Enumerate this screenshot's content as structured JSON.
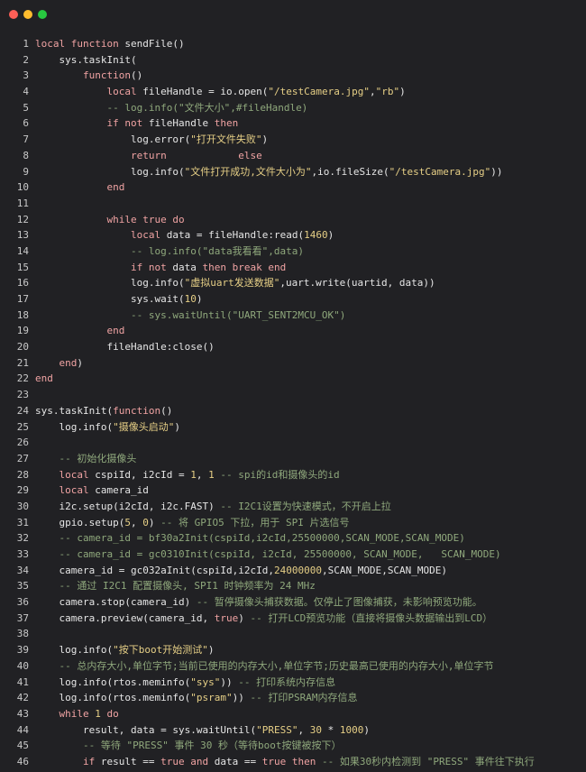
{
  "window": {
    "buttons": [
      "close",
      "minimize",
      "maximize"
    ],
    "colors": {
      "close": "#ff5f57",
      "minimize": "#febc2e",
      "maximize": "#28c840"
    }
  },
  "code_lines": [
    {
      "n": "1",
      "text": "local function sendFile()"
    },
    {
      "n": "2",
      "text": "    sys.taskInit("
    },
    {
      "n": "3",
      "text": "        function()"
    },
    {
      "n": "4",
      "text": "            local fileHandle = io.open(\"/testCamera.jpg\",\"rb\")"
    },
    {
      "n": "5",
      "text": "            -- log.info(\"文件大小\",#fileHandle)"
    },
    {
      "n": "6",
      "text": "            if not fileHandle then"
    },
    {
      "n": "7",
      "text": "                log.error(\"打开文件失败\")"
    },
    {
      "n": "8",
      "text": "                return            else"
    },
    {
      "n": "9",
      "text": "                log.info(\"文件打开成功,文件大小为\",io.fileSize(\"/testCamera.jpg\"))"
    },
    {
      "n": "10",
      "text": "            end"
    },
    {
      "n": "11",
      "text": ""
    },
    {
      "n": "12",
      "text": "            while true do"
    },
    {
      "n": "13",
      "text": "                local data = fileHandle:read(1460)"
    },
    {
      "n": "14",
      "text": "                -- log.info(\"data我看看\",data)"
    },
    {
      "n": "15",
      "text": "                if not data then break end"
    },
    {
      "n": "16",
      "text": "                log.info(\"虚拟uart发送数据\",uart.write(uartid, data))"
    },
    {
      "n": "17",
      "text": "                sys.wait(10)"
    },
    {
      "n": "18",
      "text": "                -- sys.waitUntil(\"UART_SENT2MCU_OK\")"
    },
    {
      "n": "19",
      "text": "            end"
    },
    {
      "n": "20",
      "text": "            fileHandle:close()"
    },
    {
      "n": "21",
      "text": "    end)"
    },
    {
      "n": "22",
      "text": "end"
    },
    {
      "n": "23",
      "text": ""
    },
    {
      "n": "24",
      "text": "sys.taskInit(function()"
    },
    {
      "n": "25",
      "text": "    log.info(\"摄像头启动\")"
    },
    {
      "n": "26",
      "text": ""
    },
    {
      "n": "27",
      "text": "    -- 初始化摄像头"
    },
    {
      "n": "28",
      "text": "    local cspiId, i2cId = 1, 1 -- spi的id和摄像头的id"
    },
    {
      "n": "29",
      "text": "    local camera_id"
    },
    {
      "n": "30",
      "text": "    i2c.setup(i2cId, i2c.FAST) -- I2C1设置为快速模式，不开启上拉"
    },
    {
      "n": "31",
      "text": "    gpio.setup(5, 0) -- 将 GPIO5 下拉，用于 SPI 片选信号"
    },
    {
      "n": "32",
      "text": "    -- camera_id = bf30a2Init(cspiId,i2cId,25500000,SCAN_MODE,SCAN_MODE)"
    },
    {
      "n": "33",
      "text": "    -- camera_id = gc0310Init(cspiId, i2cId, 25500000, SCAN_MODE,   SCAN_MODE)"
    },
    {
      "n": "34",
      "text": "    camera_id = gc032aInit(cspiId,i2cId,24000000,SCAN_MODE,SCAN_MODE)"
    },
    {
      "n": "35",
      "text": "    -- 通过 I2C1 配置摄像头, SPI1 时钟频率为 24 MHz"
    },
    {
      "n": "36",
      "text": "    camera.stop(camera_id) -- 暂停摄像头捕获数据。仅停止了图像捕获，未影响预览功能。"
    },
    {
      "n": "37",
      "text": "    camera.preview(camera_id, true) -- 打开LCD预览功能（直接将摄像头数据输出到LCD）"
    },
    {
      "n": "38",
      "text": ""
    },
    {
      "n": "39",
      "text": "    log.info(\"按下boot开始测试\")"
    },
    {
      "n": "40",
      "text": "    -- 总内存大小,单位字节;当前已使用的内存大小,单位字节;历史最高已使用的内存大小,单位字节"
    },
    {
      "n": "41",
      "text": "    log.info(rtos.meminfo(\"sys\")) -- 打印系统内存信息"
    },
    {
      "n": "42",
      "text": "    log.info(rtos.meminfo(\"psram\")) -- 打印PSRAM内存信息"
    },
    {
      "n": "43",
      "text": "    while 1 do"
    },
    {
      "n": "44",
      "text": "        result, data = sys.waitUntil(\"PRESS\", 30 * 1000)"
    },
    {
      "n": "45",
      "text": "        -- 等待 \"PRESS\" 事件 30 秒（等待boot按键被按下）"
    },
    {
      "n": "46",
      "text": "        if result == true and data == true then -- 如果30秒内检测到 \"PRESS\" 事件往下执行"
    }
  ]
}
